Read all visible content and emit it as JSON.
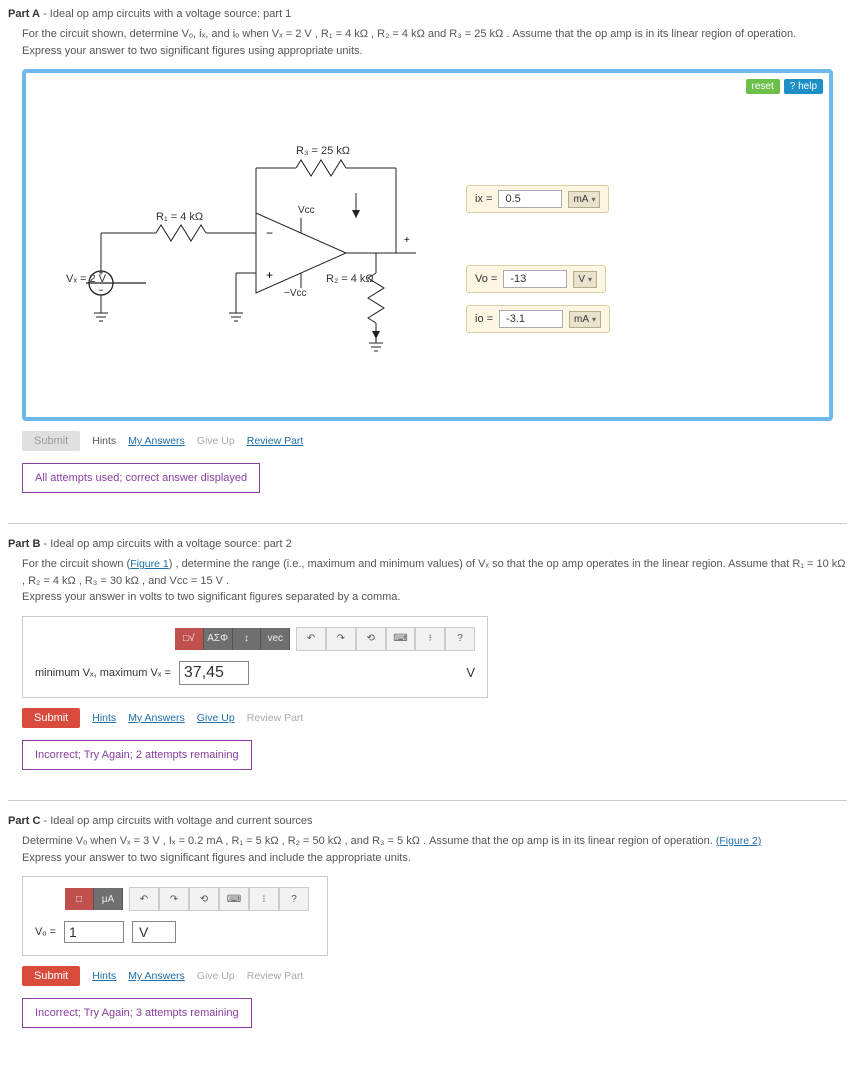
{
  "partA": {
    "title": "Part A",
    "subtitle": "- Ideal op amp circuits with a voltage source: part 1",
    "desc": "For the circuit shown, determine Vₒ, iₓ, and iₒ when Vₓ = 2 V , R₁ = 4 kΩ , R₂ = 4 kΩ and R₃ = 25 kΩ . Assume that the op amp is in its linear region of operation.",
    "instruction": "Express your answer to two significant figures using appropriate units.",
    "reset": "reset",
    "help": "help",
    "circuit": {
      "R1": "R₁ = 4 kΩ",
      "R2": "R₂ = 4 kΩ",
      "R3": "R₃ = 25 kΩ",
      "Vx": "Vₓ = 2 V",
      "Vcc": "Vcc",
      "nVcc": "−Vcc"
    },
    "answers": {
      "ix_label": "ix =",
      "ix_value": "0.5",
      "ix_unit": "mA",
      "vo_label": "Vo =",
      "vo_value": "-13",
      "vo_unit": "V",
      "io_label": "io =",
      "io_value": "-3.1",
      "io_unit": "mA"
    },
    "submit": "Submit",
    "links": {
      "hints": "Hints",
      "my_answers": "My Answers",
      "give_up": "Give Up",
      "review": "Review Part"
    },
    "status": "All attempts used; correct answer displayed"
  },
  "partB": {
    "title": "Part B",
    "subtitle": "- Ideal op amp circuits with a voltage source: part 2",
    "desc_pre": "For the circuit shown (",
    "figure_link": "Figure 1",
    "desc_post": ") , determine the range (i.e., maximum and minimum values) of Vₓ so that the op amp operates in the linear region. Assume that R₁ = 10 kΩ , R₂ = 4 kΩ , R₃ = 30 kΩ , and Vcc = 15 V .",
    "instruction": "Express your answer in volts to two significant figures separated by a comma.",
    "toolbar": [
      "□√",
      "ΑΣΦ",
      "↕",
      "vec",
      "↶",
      "↷",
      "⟲",
      "⌨",
      "⁝",
      "?"
    ],
    "input_label": "minimum Vₓ, maximum Vₓ =",
    "input_value": "37,45",
    "input_unit": "V",
    "submit": "Submit",
    "links": {
      "hints": "Hints",
      "my_answers": "My Answers",
      "give_up": "Give Up",
      "review": "Review Part"
    },
    "status": "Incorrect; Try Again; 2 attempts remaining"
  },
  "partC": {
    "title": "Part C",
    "subtitle": "- Ideal op amp circuits with voltage and current sources",
    "desc": "Determine Vₒ when Vₓ  = 3 V , Iₓ = 0.2 mA , R₁ = 5 kΩ , R₂ = 50 kΩ , and R₃ = 5 kΩ . Assume that the op amp is in its linear region of operation.",
    "figure_link": "(Figure 2)",
    "instruction": "Express your answer to two significant figures and include the appropriate units.",
    "toolbar": [
      "□",
      "μA",
      "↶",
      "↷",
      "⟲",
      "⌨",
      "⁝",
      "?"
    ],
    "input_label": "Vₒ =",
    "input_value": "1",
    "input_unit": "V",
    "submit": "Submit",
    "links": {
      "hints": "Hints",
      "my_answers": "My Answers",
      "give_up": "Give Up",
      "review": "Review Part"
    },
    "status": "Incorrect; Try Again; 3 attempts remaining"
  }
}
